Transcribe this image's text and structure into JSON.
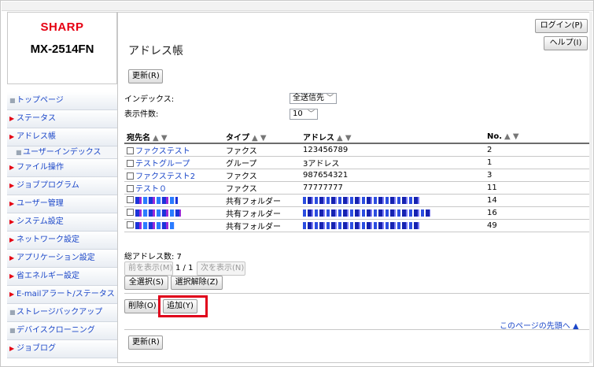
{
  "brand": {
    "logo": "SHARP",
    "model": "MX-2514FN"
  },
  "sidebar": {
    "items": [
      {
        "label": "トップページ",
        "marker": "square",
        "sub": false
      },
      {
        "label": "ステータス",
        "marker": "arrow",
        "sub": false
      },
      {
        "label": "アドレス帳",
        "marker": "arrow",
        "sub": false
      },
      {
        "label": "ユーザーインデックス",
        "marker": "square",
        "sub": true
      },
      {
        "label": "ファイル操作",
        "marker": "arrow",
        "sub": false
      },
      {
        "label": "ジョブプログラム",
        "marker": "arrow",
        "sub": false
      },
      {
        "label": "ユーザー管理",
        "marker": "arrow",
        "sub": false
      },
      {
        "label": "システム設定",
        "marker": "arrow",
        "sub": false
      },
      {
        "label": "ネットワーク設定",
        "marker": "arrow",
        "sub": false
      },
      {
        "label": "アプリケーション設定",
        "marker": "arrow",
        "sub": false
      },
      {
        "label": "省エネルギー設定",
        "marker": "arrow",
        "sub": false
      },
      {
        "label": "E-mailアラート/ステータス",
        "marker": "arrow",
        "sub": false
      },
      {
        "label": "ストレージバックアップ",
        "marker": "square",
        "sub": false
      },
      {
        "label": "デバイスクローニング",
        "marker": "square",
        "sub": false
      },
      {
        "label": "ジョブログ",
        "marker": "arrow",
        "sub": false
      }
    ]
  },
  "header": {
    "title": "アドレス帳",
    "login_label": "ログイン(P)",
    "help_label": "ヘルプ(I)"
  },
  "toolbar": {
    "refresh_label": "更新(R)"
  },
  "filters": {
    "index_label": "インデックス:",
    "index_value": "全送信先",
    "count_label": "表示件数:",
    "count_value": "10"
  },
  "table": {
    "headers": {
      "name": "宛先名",
      "type": "タイプ",
      "address": "アドレス",
      "no": "No."
    },
    "sort_marks": "▲ ▼",
    "rows": [
      {
        "name": "ファクステスト",
        "type": "ファクス",
        "address": "123456789",
        "no": "2",
        "redacted": false
      },
      {
        "name": "テストグループ",
        "type": "グループ",
        "address": "3アドレス",
        "no": "1",
        "redacted": false
      },
      {
        "name": "ファクステスト2",
        "type": "ファクス",
        "address": "987654321",
        "no": "3",
        "redacted": false
      },
      {
        "name": "テスト０",
        "type": "ファクス",
        "address": "77777777",
        "no": "11",
        "redacted": false
      },
      {
        "name": "",
        "type": "共有フォルダー",
        "address": "",
        "no": "14",
        "redacted": true
      },
      {
        "name": "",
        "type": "共有フォルダー",
        "address": "",
        "no": "16",
        "redacted": true
      },
      {
        "name": "",
        "type": "共有フォルダー",
        "address": "",
        "no": "49",
        "redacted": true
      }
    ]
  },
  "summary": {
    "total_label": "総アドレス数: 7"
  },
  "pager": {
    "prev_label": "前を表示(M)",
    "page": "1 / 1",
    "next_label": "次を表示(N)"
  },
  "selection": {
    "select_all_label": "全選択(S)",
    "deselect_label": "選択解除(Z)"
  },
  "actions": {
    "delete_label": "削除(O)",
    "add_label": "追加(Y)"
  },
  "footer": {
    "top_link": "このページの先頭へ ▲",
    "refresh_label": "更新(R)"
  },
  "colors": {
    "accent_red": "#e60012",
    "link_blue": "#1a46c8",
    "highlight_red": "#e0001b"
  }
}
